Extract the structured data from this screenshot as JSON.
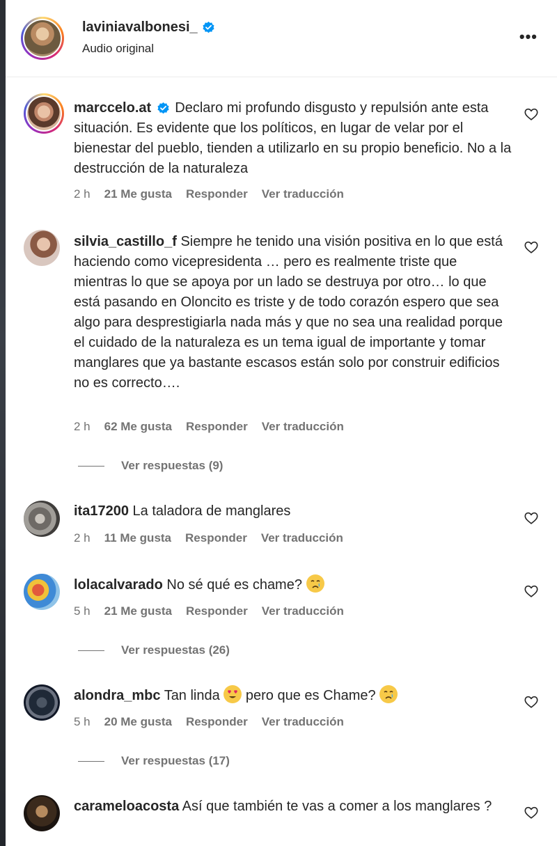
{
  "header": {
    "username": "laviniavalbonesi_",
    "subtitle": "Audio original",
    "more_icon": "more-horizontal-icon"
  },
  "comments": [
    {
      "username": "marccelo.at",
      "verified": true,
      "text": "Declaro mi profundo disgusto y repulsión ante esta situación. Es evidente que los políticos, en lugar de velar por el bienestar del pueblo, tienden a utilizarlo en su propio beneficio. No a la destrucción de la naturaleza",
      "time": "2 h",
      "likes": "21 Me gusta",
      "reply": "Responder",
      "translate": "Ver traducción"
    },
    {
      "username": "silvia_castillo_f",
      "text": "Siempre he tenido una visión positiva en lo que está haciendo como vicepresidenta … pero es realmente triste que mientras lo que se apoya por un lado se destruya por otro… lo que está pasando en Oloncito es triste y de todo corazón espero que sea algo para desprestigiarla nada más y que no sea una realidad porque el cuidado de la naturaleza es un tema igual de importante y tomar manglares que ya bastante escasos están solo por construir edificios no es correcto….",
      "time": "2 h",
      "likes": "62 Me gusta",
      "reply": "Responder",
      "translate": "Ver traducción",
      "view_replies": "Ver respuestas (9)"
    },
    {
      "username": "ita17200",
      "text": "La taladora de manglares",
      "time": "2 h",
      "likes": "11 Me gusta",
      "reply": "Responder",
      "translate": "Ver traducción"
    },
    {
      "username": "lolacalvarado",
      "text": "No sé qué es chame?",
      "time": "5 h",
      "likes": "21 Me gusta",
      "reply": "Responder",
      "translate": "Ver traducción",
      "view_replies": "Ver respuestas (26)"
    },
    {
      "username": "alondra_mbc",
      "text_a": "Tan linda",
      "text_b": "pero que es Chame?",
      "time": "5 h",
      "likes": "20 Me gusta",
      "reply": "Responder",
      "translate": "Ver traducción",
      "view_replies": "Ver respuestas (17)"
    },
    {
      "username": "carameloacosta",
      "text": "Así que también te vas a comer a los manglares ?"
    }
  ],
  "colors": {
    "text": "#262626",
    "muted": "#737373",
    "verified": "#0095f6"
  }
}
